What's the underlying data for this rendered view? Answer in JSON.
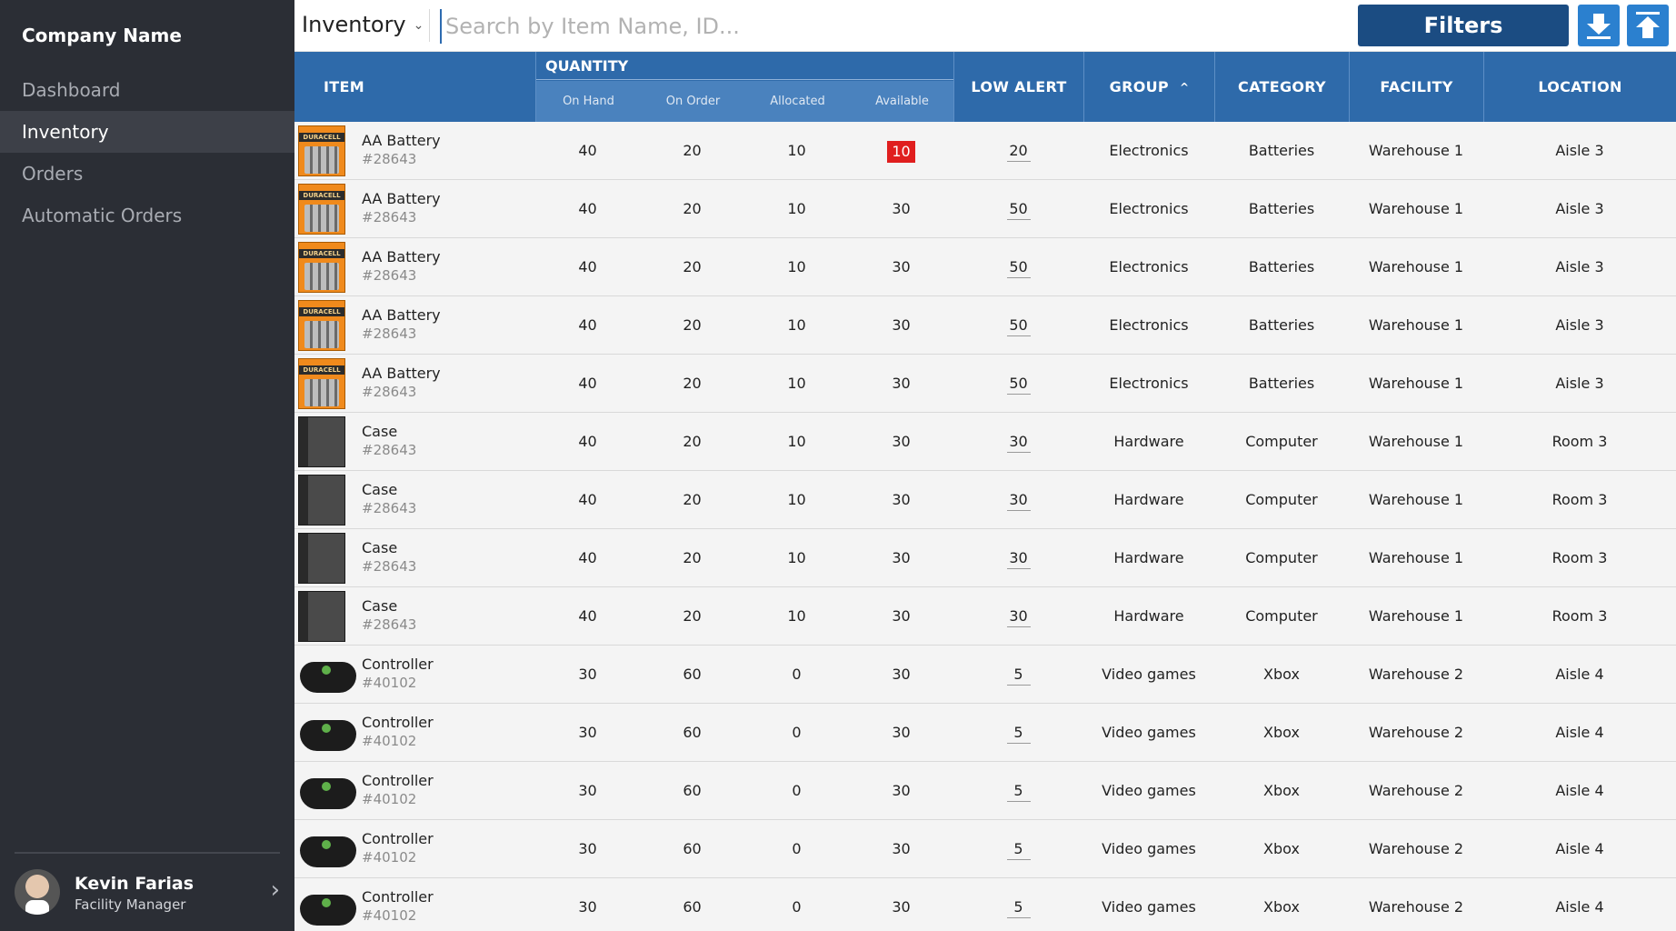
{
  "sidebar": {
    "company": "Company Name",
    "nav": [
      {
        "label": "Dashboard",
        "active": false
      },
      {
        "label": "Inventory",
        "active": true
      },
      {
        "label": "Orders",
        "active": false
      },
      {
        "label": "Automatic Orders",
        "active": false
      }
    ],
    "user": {
      "name": "Kevin Farias",
      "role": "Facility Manager"
    }
  },
  "topbar": {
    "view": "Inventory",
    "search_placeholder": "Search by Item Name, ID...",
    "filters_label": "Filters",
    "icons": {
      "download": "download-icon",
      "upload": "upload-icon"
    }
  },
  "colors": {
    "sidebar": "#2b2e35",
    "header": "#2e6aaa",
    "filters": "#1b4c82",
    "icon_btn": "#2b80cf",
    "alert": "#e01e1e"
  },
  "table": {
    "headers": {
      "item": "ITEM",
      "quantity": "QUANTITY",
      "on_hand": "On Hand",
      "on_order": "On Order",
      "allocated": "Allocated",
      "available": "Available",
      "low_alert": "LOW ALERT",
      "group": "GROUP",
      "category": "CATEGORY",
      "facility": "FACILITY",
      "location": "LOCATION"
    },
    "rows": [
      {
        "name": "AA Battery",
        "id": "#28643",
        "thumb": "battery",
        "on_hand": "40",
        "on_order": "20",
        "allocated": "10",
        "available": "10",
        "available_alert": true,
        "low_alert": "20",
        "group": "Electronics",
        "category": "Batteries",
        "facility": "Warehouse 1",
        "location": "Aisle 3"
      },
      {
        "name": "AA Battery",
        "id": "#28643",
        "thumb": "battery",
        "on_hand": "40",
        "on_order": "20",
        "allocated": "10",
        "available": "30",
        "available_alert": false,
        "low_alert": "50",
        "group": "Electronics",
        "category": "Batteries",
        "facility": "Warehouse 1",
        "location": "Aisle 3"
      },
      {
        "name": "AA Battery",
        "id": "#28643",
        "thumb": "battery",
        "on_hand": "40",
        "on_order": "20",
        "allocated": "10",
        "available": "30",
        "available_alert": false,
        "low_alert": "50",
        "group": "Electronics",
        "category": "Batteries",
        "facility": "Warehouse 1",
        "location": "Aisle 3"
      },
      {
        "name": "AA Battery",
        "id": "#28643",
        "thumb": "battery",
        "on_hand": "40",
        "on_order": "20",
        "allocated": "10",
        "available": "30",
        "available_alert": false,
        "low_alert": "50",
        "group": "Electronics",
        "category": "Batteries",
        "facility": "Warehouse 1",
        "location": "Aisle 3"
      },
      {
        "name": "AA Battery",
        "id": "#28643",
        "thumb": "battery",
        "on_hand": "40",
        "on_order": "20",
        "allocated": "10",
        "available": "30",
        "available_alert": false,
        "low_alert": "50",
        "group": "Electronics",
        "category": "Batteries",
        "facility": "Warehouse 1",
        "location": "Aisle 3"
      },
      {
        "name": "Case",
        "id": "#28643",
        "thumb": "case",
        "on_hand": "40",
        "on_order": "20",
        "allocated": "10",
        "available": "30",
        "available_alert": false,
        "low_alert": "30",
        "group": "Hardware",
        "category": "Computer",
        "facility": "Warehouse 1",
        "location": "Room 3"
      },
      {
        "name": "Case",
        "id": "#28643",
        "thumb": "case",
        "on_hand": "40",
        "on_order": "20",
        "allocated": "10",
        "available": "30",
        "available_alert": false,
        "low_alert": "30",
        "group": "Hardware",
        "category": "Computer",
        "facility": "Warehouse 1",
        "location": "Room 3"
      },
      {
        "name": "Case",
        "id": "#28643",
        "thumb": "case",
        "on_hand": "40",
        "on_order": "20",
        "allocated": "10",
        "available": "30",
        "available_alert": false,
        "low_alert": "30",
        "group": "Hardware",
        "category": "Computer",
        "facility": "Warehouse 1",
        "location": "Room 3"
      },
      {
        "name": "Case",
        "id": "#28643",
        "thumb": "case",
        "on_hand": "40",
        "on_order": "20",
        "allocated": "10",
        "available": "30",
        "available_alert": false,
        "low_alert": "30",
        "group": "Hardware",
        "category": "Computer",
        "facility": "Warehouse 1",
        "location": "Room 3"
      },
      {
        "name": "Controller",
        "id": "#40102",
        "thumb": "controller",
        "on_hand": "30",
        "on_order": "60",
        "allocated": "0",
        "available": "30",
        "available_alert": false,
        "low_alert": "5",
        "group": "Video games",
        "category": "Xbox",
        "facility": "Warehouse 2",
        "location": "Aisle 4"
      },
      {
        "name": "Controller",
        "id": "#40102",
        "thumb": "controller",
        "on_hand": "30",
        "on_order": "60",
        "allocated": "0",
        "available": "30",
        "available_alert": false,
        "low_alert": "5",
        "group": "Video games",
        "category": "Xbox",
        "facility": "Warehouse 2",
        "location": "Aisle 4"
      },
      {
        "name": "Controller",
        "id": "#40102",
        "thumb": "controller",
        "on_hand": "30",
        "on_order": "60",
        "allocated": "0",
        "available": "30",
        "available_alert": false,
        "low_alert": "5",
        "group": "Video games",
        "category": "Xbox",
        "facility": "Warehouse 2",
        "location": "Aisle 4"
      },
      {
        "name": "Controller",
        "id": "#40102",
        "thumb": "controller",
        "on_hand": "30",
        "on_order": "60",
        "allocated": "0",
        "available": "30",
        "available_alert": false,
        "low_alert": "5",
        "group": "Video games",
        "category": "Xbox",
        "facility": "Warehouse 2",
        "location": "Aisle 4"
      },
      {
        "name": "Controller",
        "id": "#40102",
        "thumb": "controller",
        "on_hand": "30",
        "on_order": "60",
        "allocated": "0",
        "available": "30",
        "available_alert": false,
        "low_alert": "5",
        "group": "Video games",
        "category": "Xbox",
        "facility": "Warehouse 2",
        "location": "Aisle 4"
      }
    ]
  }
}
